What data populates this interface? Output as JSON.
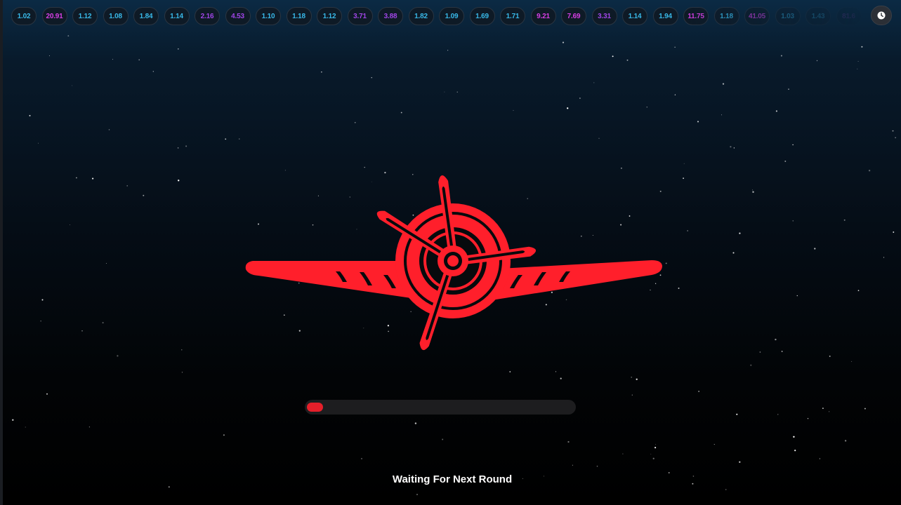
{
  "multiplier_history": [
    {
      "value": "1.02",
      "tone": "blue"
    },
    {
      "value": "20.91",
      "tone": "pink"
    },
    {
      "value": "1.12",
      "tone": "blue"
    },
    {
      "value": "1.08",
      "tone": "blue"
    },
    {
      "value": "1.84",
      "tone": "blue"
    },
    {
      "value": "1.14",
      "tone": "blue"
    },
    {
      "value": "2.16",
      "tone": "purple"
    },
    {
      "value": "4.53",
      "tone": "purple"
    },
    {
      "value": "1.10",
      "tone": "blue"
    },
    {
      "value": "1.18",
      "tone": "blue"
    },
    {
      "value": "1.12",
      "tone": "blue"
    },
    {
      "value": "3.71",
      "tone": "purple"
    },
    {
      "value": "3.88",
      "tone": "purple"
    },
    {
      "value": "1.82",
      "tone": "blue"
    },
    {
      "value": "1.09",
      "tone": "blue"
    },
    {
      "value": "1.69",
      "tone": "blue"
    },
    {
      "value": "1.71",
      "tone": "blue"
    },
    {
      "value": "9.21",
      "tone": "pink"
    },
    {
      "value": "7.69",
      "tone": "pink"
    },
    {
      "value": "3.31",
      "tone": "purple"
    },
    {
      "value": "1.14",
      "tone": "blue"
    },
    {
      "value": "1.94",
      "tone": "blue"
    },
    {
      "value": "11.75",
      "tone": "pink"
    },
    {
      "value": "1.18",
      "tone": "blue"
    },
    {
      "value": "41.05",
      "tone": "pink"
    },
    {
      "value": "1.03",
      "tone": "blue"
    },
    {
      "value": "1.43",
      "tone": "blue"
    },
    {
      "value": "81.6",
      "tone": "pink"
    }
  ],
  "history_button_icon": "clock-icon",
  "plane_icon": "propeller-plane-icon",
  "loading_progress": 0.06,
  "status_text": "Waiting For Next Round",
  "colors": {
    "accent": "#e51f2a",
    "plane": "#ff1f2b",
    "low_multiplier": "#38b8e8",
    "mid_multiplier": "#9f45e6",
    "high_multiplier": "#d63ee4"
  }
}
